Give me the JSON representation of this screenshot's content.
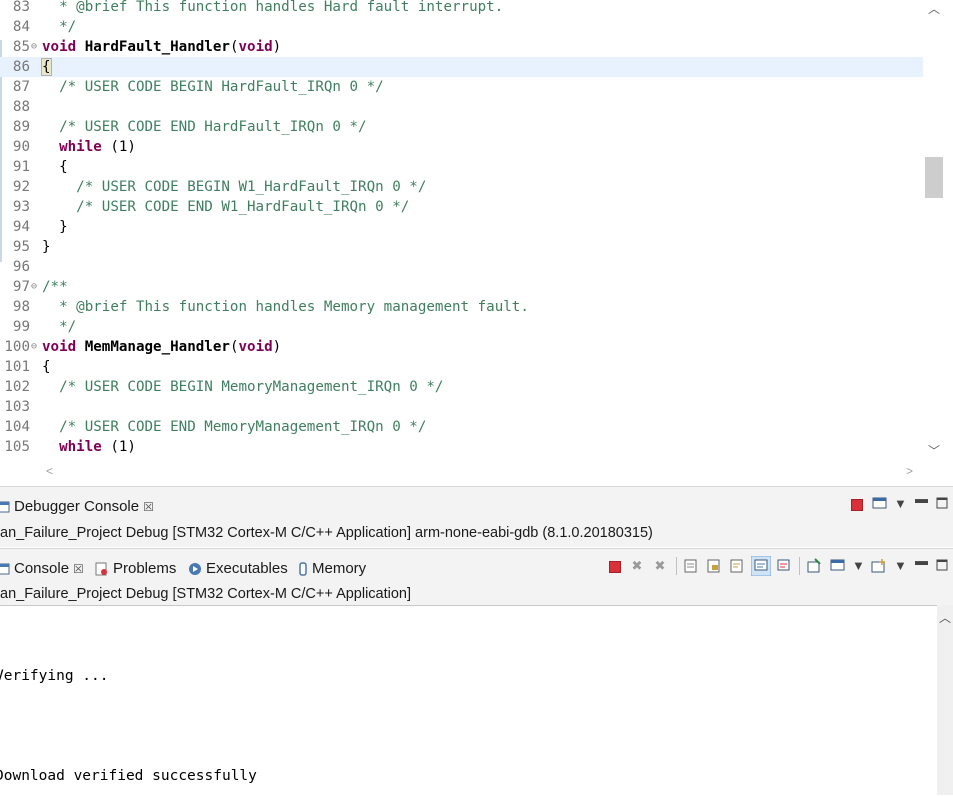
{
  "editor": {
    "lines": [
      {
        "n": "83",
        "fold": "",
        "parts": [
          {
            "t": "  * @brief This function handles Hard fault interrupt.",
            "c": "cmt"
          }
        ]
      },
      {
        "n": "84",
        "fold": "",
        "parts": [
          {
            "t": "  */",
            "c": "cmt"
          }
        ]
      },
      {
        "n": "85",
        "fold": "⊖",
        "parts": [
          {
            "t": "void",
            "c": "kw"
          },
          {
            "t": " ",
            "c": ""
          },
          {
            "t": "HardFault_Handler",
            "c": "fn"
          },
          {
            "t": "(",
            "c": ""
          },
          {
            "t": "void",
            "c": "kw"
          },
          {
            "t": ")",
            "c": ""
          }
        ]
      },
      {
        "n": "86",
        "fold": "",
        "current": true,
        "parts": [
          {
            "t": "{",
            "c": "brace-hl"
          }
        ]
      },
      {
        "n": "87",
        "fold": "",
        "parts": [
          {
            "t": "  /* USER CODE BEGIN HardFault_IRQn 0 */",
            "c": "cmt"
          }
        ]
      },
      {
        "n": "88",
        "fold": "",
        "parts": []
      },
      {
        "n": "89",
        "fold": "",
        "parts": [
          {
            "t": "  /* USER CODE END HardFault_IRQn 0 */",
            "c": "cmt"
          }
        ]
      },
      {
        "n": "90",
        "fold": "",
        "parts": [
          {
            "t": "  ",
            "c": ""
          },
          {
            "t": "while",
            "c": "kw"
          },
          {
            "t": " (1)",
            "c": ""
          }
        ]
      },
      {
        "n": "91",
        "fold": "",
        "parts": [
          {
            "t": "  {",
            "c": ""
          }
        ]
      },
      {
        "n": "92",
        "fold": "",
        "parts": [
          {
            "t": "    /* USER CODE BEGIN W1_HardFault_IRQn 0 */",
            "c": "cmt"
          }
        ]
      },
      {
        "n": "93",
        "fold": "",
        "parts": [
          {
            "t": "    /* USER CODE END W1_HardFault_IRQn 0 */",
            "c": "cmt"
          }
        ]
      },
      {
        "n": "94",
        "fold": "",
        "parts": [
          {
            "t": "  }",
            "c": ""
          }
        ]
      },
      {
        "n": "95",
        "fold": "",
        "parts": [
          {
            "t": "}",
            "c": ""
          }
        ]
      },
      {
        "n": "96",
        "fold": "",
        "parts": []
      },
      {
        "n": "97",
        "fold": "⊖",
        "parts": [
          {
            "t": "/**",
            "c": "cmt"
          }
        ]
      },
      {
        "n": "98",
        "fold": "",
        "parts": [
          {
            "t": "  * @brief This function handles Memory management fault.",
            "c": "cmt"
          }
        ]
      },
      {
        "n": "99",
        "fold": "",
        "parts": [
          {
            "t": "  */",
            "c": "cmt"
          }
        ]
      },
      {
        "n": "100",
        "fold": "⊖",
        "parts": [
          {
            "t": "void",
            "c": "kw"
          },
          {
            "t": " ",
            "c": ""
          },
          {
            "t": "MemManage_Handler",
            "c": "fn"
          },
          {
            "t": "(",
            "c": ""
          },
          {
            "t": "void",
            "c": "kw"
          },
          {
            "t": ")",
            "c": ""
          }
        ]
      },
      {
        "n": "101",
        "fold": "",
        "parts": [
          {
            "t": "{",
            "c": ""
          }
        ]
      },
      {
        "n": "102",
        "fold": "",
        "parts": [
          {
            "t": "  /* USER CODE BEGIN MemoryManagement_IRQn 0 */",
            "c": "cmt"
          }
        ]
      },
      {
        "n": "103",
        "fold": "",
        "parts": []
      },
      {
        "n": "104",
        "fold": "",
        "parts": [
          {
            "t": "  /* USER CODE END MemoryManagement_IRQn 0 */",
            "c": "cmt"
          }
        ]
      },
      {
        "n": "105",
        "fold": "",
        "parts": [
          {
            "t": "  ",
            "c": ""
          },
          {
            "t": "while",
            "c": "kw"
          },
          {
            "t": " (1)",
            "c": ""
          }
        ]
      }
    ]
  },
  "debugger_console": {
    "tab_label": "Debugger Console",
    "close_glyph": "☒",
    "session": "an_Failure_Project Debug [STM32 Cortex-M C/C++ Application] arm-none-eabi-gdb (8.1.0.20180315)"
  },
  "console_view": {
    "tabs": [
      {
        "label": "Console",
        "icon": "console-icon",
        "closable": true
      },
      {
        "label": "Problems",
        "icon": "problems-icon"
      },
      {
        "label": "Executables",
        "icon": "executables-icon"
      },
      {
        "label": "Memory",
        "icon": "memory-icon"
      }
    ],
    "close_glyph": "☒",
    "session": "an_Failure_Project Debug [STM32 Cortex-M C/C++ Application]",
    "output": [
      "Verifying ...",
      "Download verified successfully"
    ]
  },
  "colors": {
    "comment": "#3f7f5f",
    "keyword": "#7f0055",
    "current_line": "#e8f2fe",
    "terminate_red": "#d9303a"
  }
}
